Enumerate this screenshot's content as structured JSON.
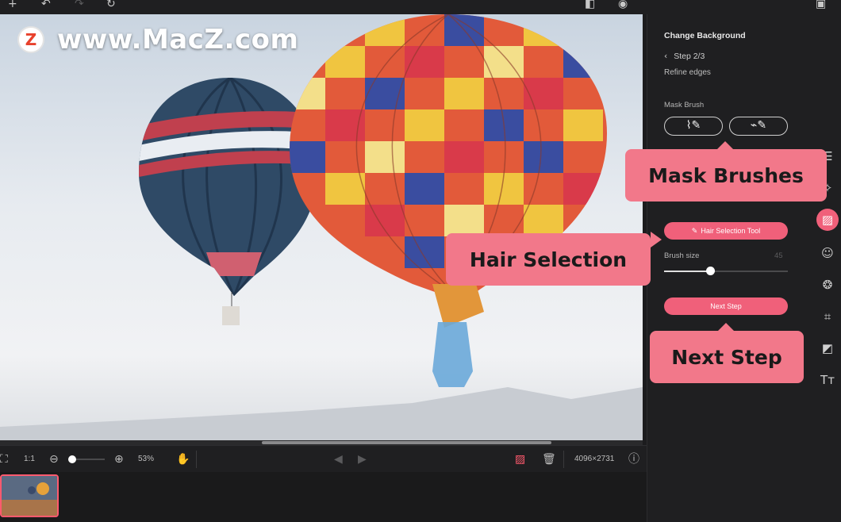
{
  "watermark": {
    "logo_letter": "Z",
    "text": "www.MacZ.com"
  },
  "topbar": {
    "icons": [
      "plus-icon",
      "undo-icon",
      "redo-icon",
      "reset-icon",
      "compare-icon",
      "eye-icon",
      "save-icon"
    ]
  },
  "bottombar": {
    "fit_icon": "fit-screen-icon",
    "actual_size": "1:1",
    "zoom_out_icon": "zoom-out-icon",
    "zoom_in_icon": "zoom-in-icon",
    "zoom_level": "53%",
    "zoom_fraction": 0.1,
    "hand_icon": "hand-icon",
    "prev_icon": "prev-icon",
    "next_icon": "next-icon",
    "image_icon": "image-icon",
    "trash_icon": "trash-icon",
    "dimensions": "4096×2731",
    "info_icon": "info-icon"
  },
  "panel": {
    "title": "Change Background",
    "step": "Step 2/3",
    "subtitle": "Refine edges",
    "mask_brush_label": "Mask Brush",
    "brush_add_icon": "brush-add-icon",
    "brush_erase_icon": "brush-erase-icon",
    "hair_selection_button": "Hair Selection Tool",
    "brush_size_label": "Brush size",
    "brush_size_value": "45",
    "brush_size_fraction": 0.37,
    "next_step_button": "Next Step"
  },
  "rail": {
    "icons": [
      "adjust-icon",
      "ai-icon",
      "background-icon",
      "face-icon",
      "effects-icon",
      "crop-icon",
      "frame-icon",
      "text-icon"
    ],
    "active": "background-icon"
  },
  "callouts": {
    "mask_brushes": "Mask Brushes",
    "hair_selection": "Hair Selection",
    "next_step": "Next Step"
  },
  "colors": {
    "accent": "#f0607a",
    "callout": "#f2788a",
    "panel_bg": "#1f1f21"
  }
}
